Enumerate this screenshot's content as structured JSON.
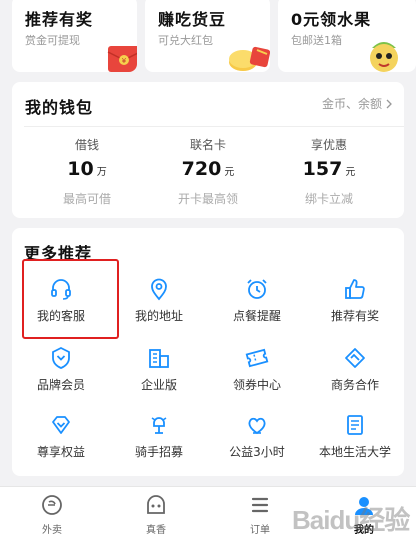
{
  "promos": [
    {
      "title": "推荐有奖",
      "sub": "赏金可提现",
      "icon": "red-envelope-icon"
    },
    {
      "title": "赚吃货豆",
      "sub": "可兑大红包",
      "icon": "coins-icon"
    },
    {
      "title": "0元领水果",
      "sub": "包邮送1箱",
      "icon": "fruit-mascot-icon"
    }
  ],
  "wallet": {
    "title": "我的钱包",
    "more": "金币、余额",
    "items": [
      {
        "label": "借钱",
        "value": "10",
        "unit": "万",
        "desc": "最高可借"
      },
      {
        "label": "联名卡",
        "value": "720",
        "unit": "元",
        "desc": "开卡最高领"
      },
      {
        "label": "享优惠",
        "value": "157",
        "unit": "元",
        "desc": "绑卡立减"
      }
    ]
  },
  "more": {
    "title": "更多推荐",
    "items": [
      {
        "label": "我的客服",
        "icon": "headset-icon"
      },
      {
        "label": "我的地址",
        "icon": "location-pin-icon"
      },
      {
        "label": "点餐提醒",
        "icon": "alarm-clock-icon"
      },
      {
        "label": "推荐有奖",
        "icon": "thumbs-up-icon"
      },
      {
        "label": "品牌会员",
        "icon": "shield-chevron-icon"
      },
      {
        "label": "企业版",
        "icon": "building-icon"
      },
      {
        "label": "领券中心",
        "icon": "ticket-icon"
      },
      {
        "label": "商务合作",
        "icon": "handshake-icon"
      },
      {
        "label": "尊享权益",
        "icon": "diamond-icon"
      },
      {
        "label": "骑手招募",
        "icon": "rider-icon"
      },
      {
        "label": "公益3小时",
        "icon": "heart-hand-icon"
      },
      {
        "label": "本地生活大学",
        "icon": "book-icon"
      }
    ]
  },
  "tabs": [
    {
      "label": "外卖",
      "icon": "eleme-logo-icon",
      "active": false
    },
    {
      "label": "真香",
      "icon": "mascot-face-icon",
      "active": false
    },
    {
      "label": "订单",
      "icon": "list-icon",
      "active": false
    },
    {
      "label": "我的",
      "icon": "profile-icon",
      "active": true
    }
  ],
  "colors": {
    "accent": "#1a90ff",
    "highlight": "#e02020",
    "red_envelope": "#e8453c"
  },
  "watermark": "Baidu经验"
}
